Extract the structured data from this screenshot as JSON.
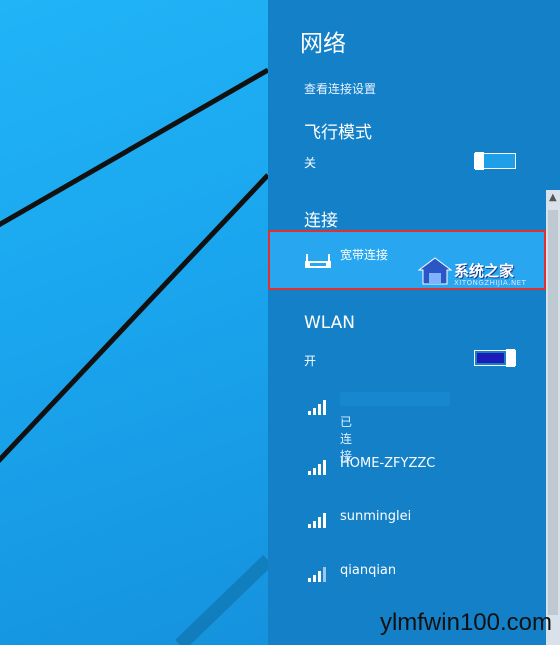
{
  "panel": {
    "title": "网络",
    "view_settings_link": "查看连接设置",
    "airplane": {
      "heading": "飞行模式",
      "state_label": "关",
      "on": false
    },
    "connections": {
      "heading": "连接",
      "broadband": {
        "label": "宽带连接",
        "icon": "broadband-modem-icon"
      }
    },
    "wlan": {
      "heading": "WLAN",
      "state_label": "开",
      "on": true,
      "networks": [
        {
          "name": "",
          "status": "已连接",
          "icon": "wifi-signal-icon"
        },
        {
          "name": "HOME-ZFYZZC",
          "status": "",
          "icon": "wifi-signal-icon"
        },
        {
          "name": "sunminglei",
          "status": "",
          "icon": "wifi-signal-icon"
        },
        {
          "name": "qianqian",
          "status": "",
          "icon": "wifi-signal-icon"
        }
      ]
    }
  },
  "watermark": {
    "brand": "系统之家",
    "url": "XITONGZHIJIA.NET"
  },
  "site_watermark": "ylmfwin100.com",
  "colors": {
    "panel_bg": "#1380c8",
    "highlight": "#28a7f0",
    "wlan_toggle": "#1c1cb8",
    "red_outline": "#e0302f"
  }
}
